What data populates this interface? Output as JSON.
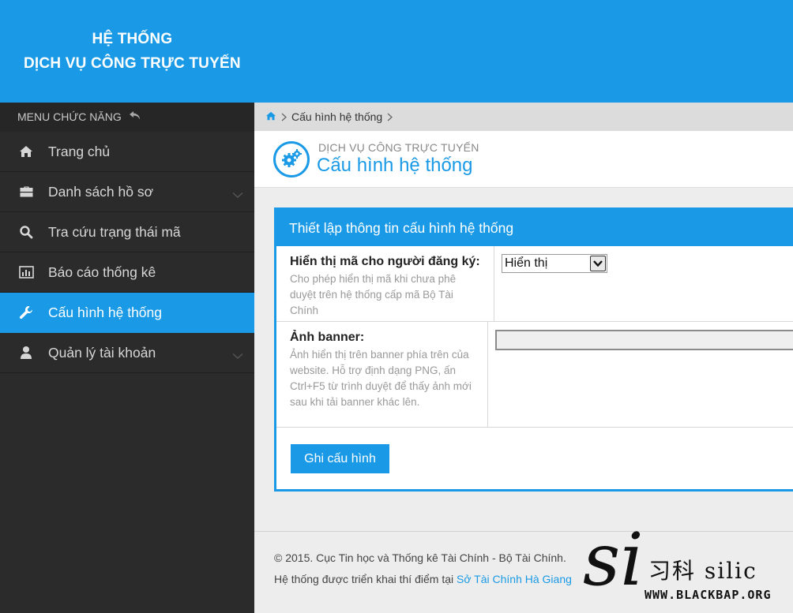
{
  "header": {
    "title_line1": "HỆ THỐNG",
    "title_line2": "DỊCH VỤ CÔNG TRỰC TUYẾN",
    "bg_color": "#1a9ae6"
  },
  "sidebar": {
    "menu_title": "MENU CHỨC NĂNG",
    "menu_back_icon": "undo-arrow-icon",
    "items": [
      {
        "label": "Trang chủ",
        "icon": "home-icon",
        "active": false,
        "has_submenu": false
      },
      {
        "label": "Danh sách hồ sơ",
        "icon": "briefcase-icon",
        "active": false,
        "has_submenu": true
      },
      {
        "label": "Tra cứu trạng thái mã",
        "icon": "search-icon",
        "active": false,
        "has_submenu": false
      },
      {
        "label": "Báo cáo thống kê",
        "icon": "bar-chart-icon",
        "active": false,
        "has_submenu": false
      },
      {
        "label": "Cấu hình hệ thống",
        "icon": "wrench-icon",
        "active": true,
        "has_submenu": false
      },
      {
        "label": "Quản lý tài khoản",
        "icon": "user-icon",
        "active": false,
        "has_submenu": true
      }
    ]
  },
  "breadcrumb": {
    "home_icon": "home-icon",
    "current": "Cấu hình hệ thống"
  },
  "page": {
    "subtitle": "DỊCH VỤ CÔNG TRỰC TUYẾN",
    "title": "Cấu hình hệ thống",
    "icon": "gears-icon"
  },
  "panel": {
    "heading": "Thiết lập thông tin cấu hình hệ thống",
    "rows": [
      {
        "label": "Hiển thị mã cho người đăng ký:",
        "description_lines": [
          "Cho phép hiển thị mã khi chưa phê",
          "duyệt trên hệ thống cấp mã Bộ Tài",
          "Chính"
        ],
        "select_value": "Hiển thị"
      },
      {
        "label": "Ảnh banner:",
        "description_lines": [
          "Ảnh hiển thị trên banner phía trên của",
          "website. Hỗ trợ định dạng PNG, ấn",
          "Ctrl+F5 từ trình duyệt để thấy ảnh mới",
          "sau khi tải banner khác lên."
        ]
      }
    ],
    "save_button": "Ghi cấu hình"
  },
  "footer": {
    "copyright": "© 2015. Cục Tin học và Thống kê Tài Chính - Bộ Tài Chính.",
    "deploy_prefix": "Hệ thống được triển khai thí điểm tại",
    "deploy_link": "Sở Tài Chính Hà Giang"
  },
  "watermark": {
    "script": "si",
    "chinese": "习科 silic",
    "url": "WWW.BLACKBAP.ORG"
  },
  "colors": {
    "accent": "#1a9ae6",
    "sidebar_bg": "#2b2b2b"
  }
}
